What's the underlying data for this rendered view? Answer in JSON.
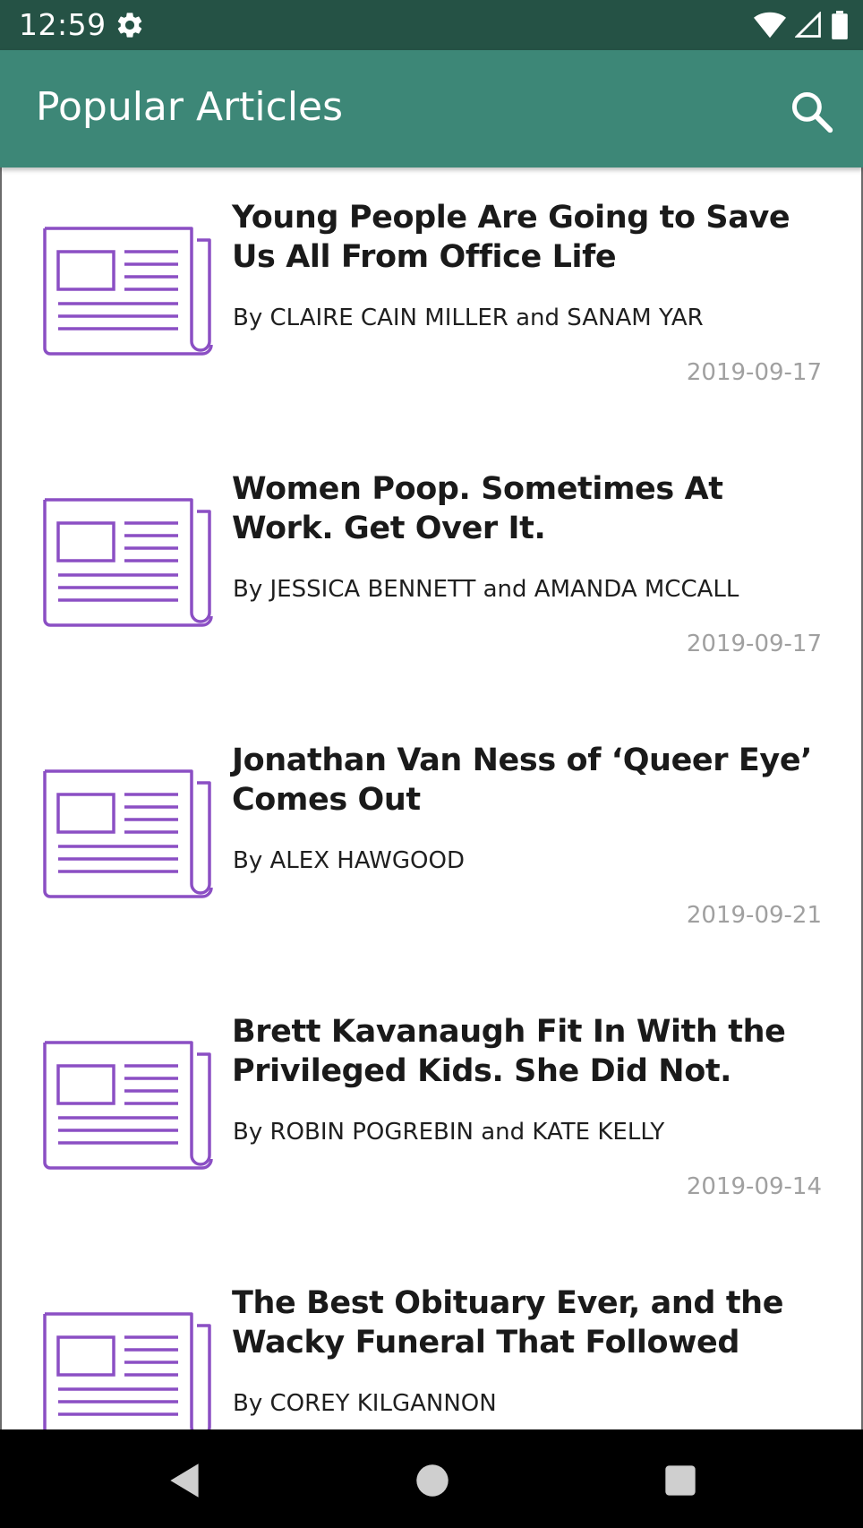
{
  "status_bar": {
    "time": "12:59",
    "icons": [
      "gear-icon",
      "wifi-icon",
      "cellular-icon",
      "battery-icon"
    ]
  },
  "app_bar": {
    "title": "Popular Articles",
    "search_icon": "search-icon",
    "background": "#3d8777",
    "status_background": "#255245"
  },
  "articles": [
    {
      "title": "Young People Are Going to Save Us All From Office Life",
      "byline": "By CLAIRE CAIN MILLER and SANAM YAR",
      "date": "2019-09-17",
      "icon": "newspaper-icon"
    },
    {
      "title": "Women Poop. Sometimes At Work. Get Over It.",
      "byline": "By JESSICA BENNETT and AMANDA MCCALL",
      "date": "2019-09-17",
      "icon": "newspaper-icon"
    },
    {
      "title": "Jonathan Van Ness of ‘Queer Eye’ Comes Out",
      "byline": "By ALEX HAWGOOD",
      "date": "2019-09-21",
      "icon": "newspaper-icon"
    },
    {
      "title": "Brett Kavanaugh Fit In With the Privileged Kids. She Did Not.",
      "byline": "By ROBIN POGREBIN and KATE KELLY",
      "date": "2019-09-14",
      "icon": "newspaper-icon"
    },
    {
      "title": "The Best Obituary Ever, and the Wacky Funeral That Followed",
      "byline": "By COREY KILGANNON",
      "date": "",
      "icon": "newspaper-icon"
    }
  ],
  "icon_color": "#8b4fc4",
  "nav_bar": {
    "buttons": [
      "back-icon",
      "home-icon",
      "recents-icon"
    ]
  }
}
